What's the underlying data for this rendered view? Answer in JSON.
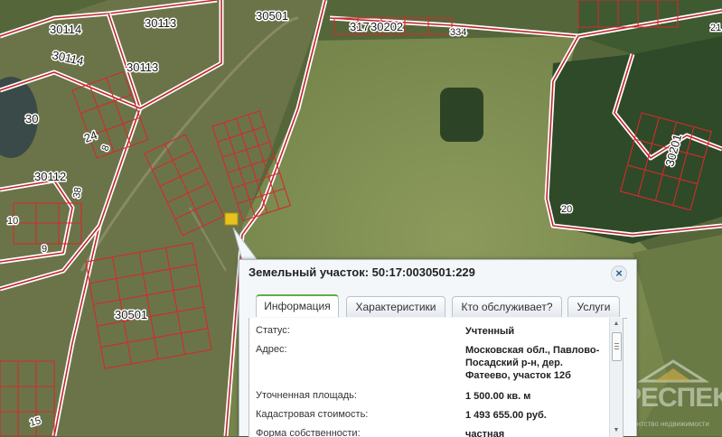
{
  "map": {
    "labels": {
      "zone_30114_a": "30114",
      "zone_30114_b": "30114",
      "zone_30113_a": "30113",
      "zone_30113_b": "30113",
      "zone_30501_a": "30501",
      "zone_30501_b": "30501",
      "zone_317": "317",
      "zone_30202": "30202",
      "zone_334": "334",
      "zone_30201": "30201",
      "zone_30112": "30112",
      "num_30": "30",
      "num_24": "24",
      "num_8": "8",
      "num_38": "38",
      "num_10": "10",
      "num_9": "9",
      "num_20": "20",
      "num_15": "15",
      "num_21": "21"
    },
    "colors": {
      "boundary": "#ffffff",
      "parcel": "#d12b2f",
      "selected_parcel": "#e8c21e"
    }
  },
  "popup": {
    "title": "Земельный участок: 50:17:0030501:229",
    "close_glyph": "×",
    "tabs": [
      {
        "label": "Информация",
        "active": true
      },
      {
        "label": "Характеристики",
        "active": false
      },
      {
        "label": "Кто обслуживает?",
        "active": false
      },
      {
        "label": "Услуги",
        "active": false
      }
    ],
    "fields": [
      {
        "label": "Статус:",
        "value": "Учтенный"
      },
      {
        "label": "Адрес:",
        "value": "Московская обл., Павлово-Посадский р-н, дер. Фатеево, участок 12б"
      },
      {
        "label": "Уточненная площадь:",
        "value": "1 500.00 кв. м"
      },
      {
        "label": "Кадастровая стоимость:",
        "value": "1 493 655.00 руб."
      },
      {
        "label": "Форма собственности:",
        "value": "частная"
      }
    ]
  },
  "watermark": {
    "text": "РЕСПЕКТ",
    "subtext": "Агентство недвижимости"
  }
}
